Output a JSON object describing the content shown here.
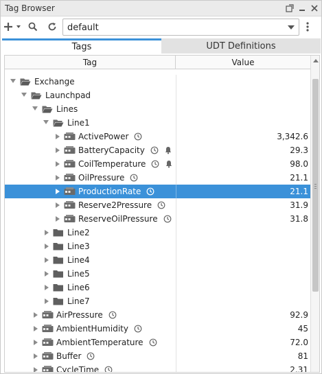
{
  "window": {
    "title": "Tag Browser"
  },
  "toolbar": {
    "provider_value": "default"
  },
  "tabs": [
    {
      "label": "Tags"
    },
    {
      "label": "UDT Definitions"
    }
  ],
  "columns": {
    "tag": "Tag",
    "value": "Value"
  },
  "colors": {
    "selection": "#3b91d9",
    "tab_accent": "#3b91d9"
  },
  "rows": [
    {
      "level": 0,
      "expand": "down",
      "icon": "folder-open-icon",
      "label": "Exchange"
    },
    {
      "level": 1,
      "expand": "down",
      "icon": "folder-open-icon",
      "label": "Launchpad"
    },
    {
      "level": 2,
      "expand": "down",
      "icon": "folder-open-icon",
      "label": "Lines"
    },
    {
      "level": 3,
      "expand": "down",
      "icon": "folder-open-icon",
      "label": "Line1"
    },
    {
      "level": 4,
      "expand": "right",
      "icon": "udt-instance-icon",
      "label": "ActivePower",
      "history": true,
      "value": "3,342.6"
    },
    {
      "level": 4,
      "expand": "right",
      "icon": "udt-instance-icon",
      "label": "BatteryCapacity",
      "history": true,
      "alarm": true,
      "value": "29.3"
    },
    {
      "level": 4,
      "expand": "right",
      "icon": "udt-instance-icon",
      "label": "CoilTemperature",
      "history": true,
      "alarm": true,
      "value": "98.0"
    },
    {
      "level": 4,
      "expand": "right",
      "icon": "udt-instance-icon",
      "label": "OilPressure",
      "history": true,
      "value": "21.1"
    },
    {
      "level": 4,
      "expand": "right",
      "icon": "udt-instance-icon",
      "label": "ProductionRate",
      "history": true,
      "value": "21.1",
      "selected": true
    },
    {
      "level": 4,
      "expand": "right",
      "icon": "udt-instance-icon",
      "label": "Reserve2Pressure",
      "history": true,
      "value": "31.9"
    },
    {
      "level": 4,
      "expand": "right",
      "icon": "udt-instance-icon",
      "label": "ReserveOilPressure",
      "history": true,
      "value": "31.8"
    },
    {
      "level": 3,
      "expand": "right",
      "icon": "folder-icon",
      "label": "Line2"
    },
    {
      "level": 3,
      "expand": "right",
      "icon": "folder-icon",
      "label": "Line3"
    },
    {
      "level": 3,
      "expand": "right",
      "icon": "folder-icon",
      "label": "Line4"
    },
    {
      "level": 3,
      "expand": "right",
      "icon": "folder-icon",
      "label": "Line5"
    },
    {
      "level": 3,
      "expand": "right",
      "icon": "folder-icon",
      "label": "Line6"
    },
    {
      "level": 3,
      "expand": "right",
      "icon": "folder-icon",
      "label": "Line7"
    },
    {
      "level": 2,
      "expand": "right",
      "icon": "udt-instance-icon",
      "label": "AirPressure",
      "history": true,
      "value": "92.9"
    },
    {
      "level": 2,
      "expand": "right",
      "icon": "udt-instance-icon",
      "label": "AmbientHumidity",
      "history": true,
      "value": "45"
    },
    {
      "level": 2,
      "expand": "right",
      "icon": "udt-instance-icon",
      "label": "AmbientTemperature",
      "history": true,
      "value": "72.0"
    },
    {
      "level": 2,
      "expand": "right",
      "icon": "udt-instance-icon",
      "label": "Buffer",
      "history": true,
      "value": "81"
    },
    {
      "level": 2,
      "expand": "right",
      "icon": "udt-instance-icon",
      "label": "CycleTime",
      "history": true,
      "value": "2.31"
    }
  ]
}
